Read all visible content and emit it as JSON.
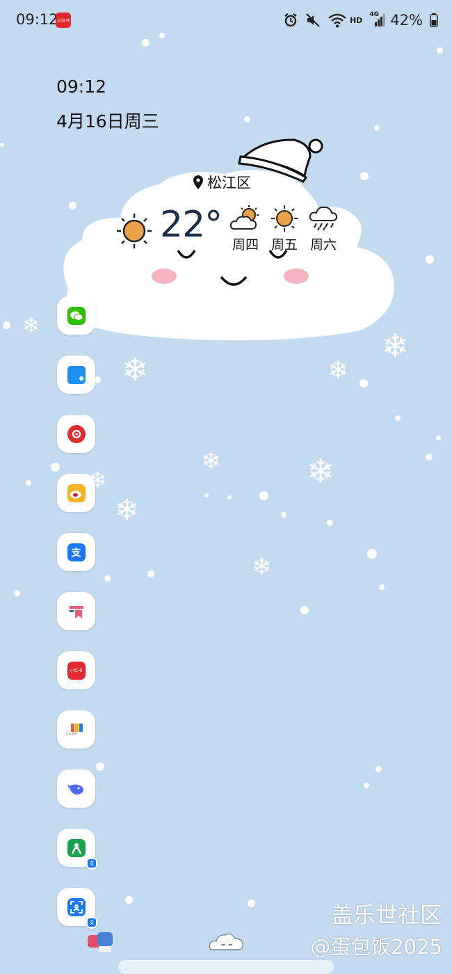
{
  "status_bar": {
    "time": "09:12",
    "notification_app": "小红书",
    "network_badge": "HD",
    "signal_badge": "4G",
    "battery": "42%"
  },
  "clock_widget": {
    "time": "09:12",
    "date": "4月16日周三"
  },
  "weather_widget": {
    "location": "松江区",
    "temperature": "22°",
    "current_icon": "sun-icon",
    "forecast": [
      {
        "day": "周四",
        "icon": "partly-cloudy-icon"
      },
      {
        "day": "周五",
        "icon": "sun-icon"
      },
      {
        "day": "周六",
        "icon": "rain-icon"
      }
    ]
  },
  "dock_apps": [
    {
      "name": "wechat",
      "icon": "wechat-icon",
      "color": "#2dc100"
    },
    {
      "name": "tablet-app",
      "icon": "blue-rect-icon",
      "color": "#1e8ff2"
    },
    {
      "name": "netease-music",
      "icon": "netease-icon",
      "color": "#e02b2b"
    },
    {
      "name": "weibo",
      "icon": "weibo-icon",
      "color": "#f5a623"
    },
    {
      "name": "alipay",
      "icon": "alipay-icon",
      "color": "#1678ff"
    },
    {
      "name": "bookmark-app",
      "icon": "bookmark-icon",
      "color": "#e85c7a"
    },
    {
      "name": "xiaohongshu",
      "icon": "xiaohongshu-icon",
      "color": "#e5282f",
      "label": "小红书"
    },
    {
      "name": "dazhong",
      "icon": "dazhong-icon",
      "color": "#f3b400",
      "label": "大众点评"
    },
    {
      "name": "deepseek",
      "icon": "whale-icon",
      "color": "#4d6bfe"
    },
    {
      "name": "alipay-person",
      "icon": "person-icon",
      "color": "#1aa34a"
    },
    {
      "name": "alipay-scan",
      "icon": "scan-icon",
      "color": "#1678ff"
    }
  ],
  "watermark": {
    "line1": "盖乐世社区",
    "line2": "@蛋包饭2025"
  },
  "colors": {
    "wallpaper": "#c3dbf1",
    "sun": "#e9a24a"
  }
}
